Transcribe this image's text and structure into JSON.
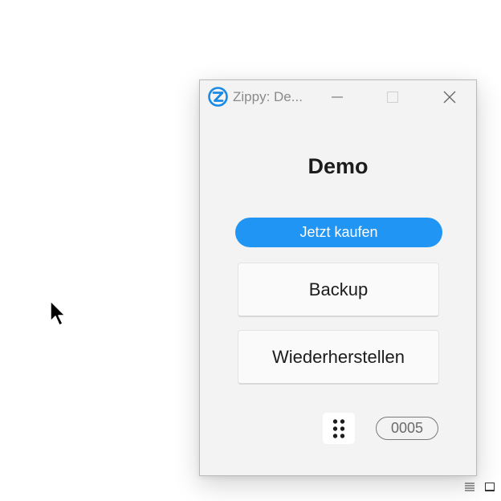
{
  "window": {
    "title": "Zippy: De...",
    "app_icon": "zippy-logo-icon",
    "controls": {
      "minimize": "minimize-icon",
      "maximize": "maximize-icon",
      "close": "close-icon"
    }
  },
  "main": {
    "heading": "Demo",
    "buy_label": "Jetzt kaufen",
    "backup_label": "Backup",
    "restore_label": "Wiederherstellen",
    "menu_icon": "six-dots-icon",
    "counter": "0005"
  },
  "colors": {
    "accent": "#2195f3",
    "window_bg": "#f3f3f3",
    "text": "#1c1c1c"
  },
  "tray": {
    "icons": [
      "list-icon",
      "window-icon"
    ]
  }
}
